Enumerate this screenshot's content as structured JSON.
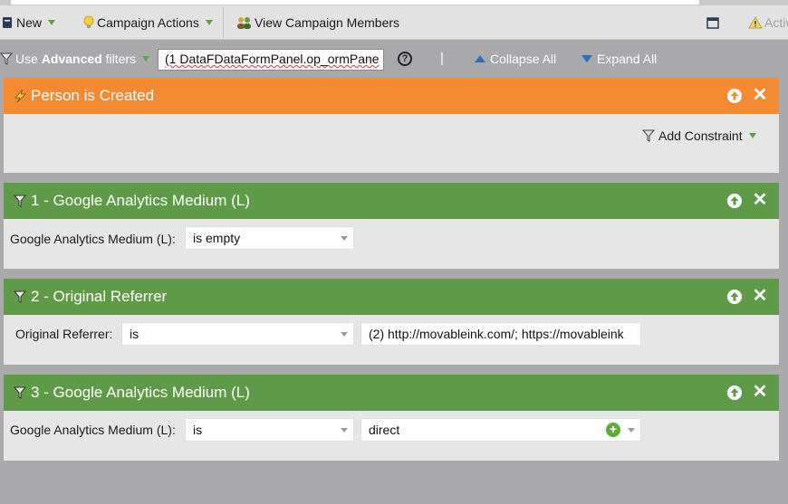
{
  "toolbar": {
    "new_label": "New",
    "campaign_actions_label": "Campaign Actions",
    "view_members_label": "View Campaign Members",
    "active_label": "Activ"
  },
  "filterbar": {
    "use_label": "Use",
    "advanced_label": "Advanced",
    "filters_label": "filters",
    "filter_value": "(1 DataFDataFormPanel.op_ormPane",
    "help_label": "?",
    "separator": "|",
    "collapse_all_label": "Collapse All",
    "expand_all_label": "Expand All"
  },
  "trigger": {
    "title": "Person is Created",
    "add_constraint_label": "Add Constraint"
  },
  "filters": [
    {
      "title": "1 - Google Analytics Medium (L)",
      "field_label": "Google Analytics Medium (L):",
      "operator": "is empty",
      "value": ""
    },
    {
      "title": "2 - Original Referrer",
      "field_label": "Original Referrer:",
      "operator": "is",
      "value": "(2) http://movableink.com/; https://movableink"
    },
    {
      "title": "3 - Google Analytics Medium (L)",
      "field_label": "Google Analytics Medium (L):",
      "operator": "is",
      "value": "direct"
    }
  ],
  "colors": {
    "trigger_header": "#f48a32",
    "filter_header": "#5f9a48",
    "panel_body": "#e6e6e6",
    "canvas": "#a9a9ab",
    "link_blue": "#2f6fb8"
  }
}
